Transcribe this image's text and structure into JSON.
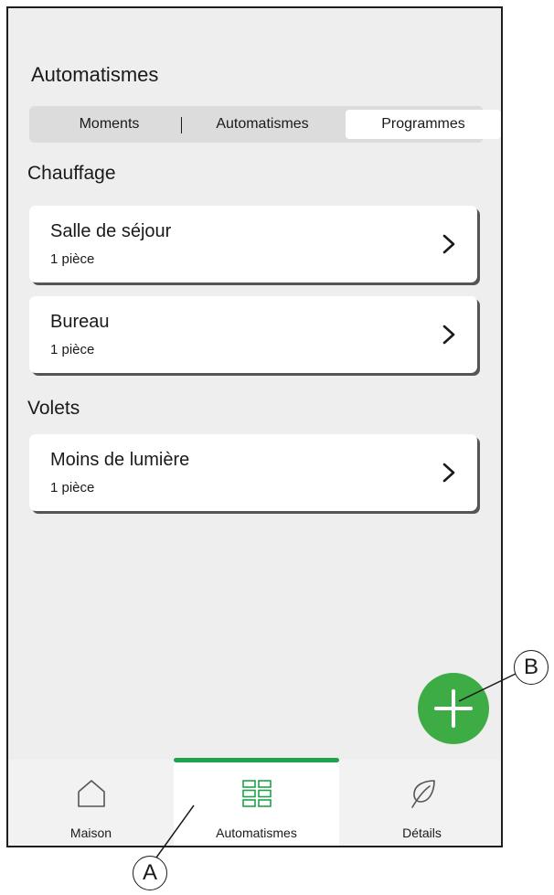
{
  "page": {
    "title": "Automatismes"
  },
  "segmented": {
    "moments": "Moments",
    "automatismes": "Automatismes",
    "programmes": "Programmes",
    "selected": "Programmes"
  },
  "sections": {
    "chauffage": {
      "title": "Chauffage",
      "items": [
        {
          "title": "Salle de séjour",
          "subtitle": "1 pièce"
        },
        {
          "title": "Bureau",
          "subtitle": "1 pièce"
        }
      ]
    },
    "volets": {
      "title": "Volets",
      "items": [
        {
          "title": "Moins de lumière",
          "subtitle": "1 pièce"
        }
      ]
    }
  },
  "fab": {
    "icon": "plus-icon",
    "color": "#3dac44"
  },
  "bottom_nav": {
    "active": "Automatismes",
    "accent": "#1ea34a",
    "tabs": [
      {
        "label": "Maison",
        "icon": "home-icon"
      },
      {
        "label": "Automatismes",
        "icon": "grid-icon"
      },
      {
        "label": "Détails",
        "icon": "leaf-icon"
      }
    ]
  },
  "callouts": {
    "a": "A",
    "b": "B"
  }
}
